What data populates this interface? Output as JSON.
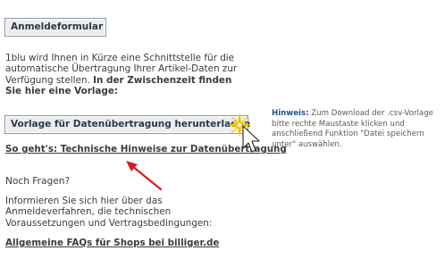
{
  "form": {
    "anmelde_button": "Anmeldeformular",
    "intro_text": "1blu wird Ihnen in Kürze eine Schnittstelle für die automatische Übertragung Ihrer Artikel-Daten zur Verfügung stellen.",
    "intro_bold": "In der Zwischenzeit finden Sie hier eine Vorlage:",
    "vorlage_button": "Vorlage für Datenübertragung herunterladen",
    "technik_link": "So geht's: Technische Hinweise zur Datenübertragung",
    "fragen_heading": "Noch Fragen?",
    "info_text": "Informieren Sie sich hier über das Anmeldeverfahren, die technischen Voraussetzungen und Vertragsbedingungen:",
    "faq_link": "Allgemeine FAQs für Shops bei billiger.de"
  },
  "hint": {
    "label": "Hinweis:",
    "text": "Zum Download der .csv-Vorlage bitte rechte Maustaste klicken und anschließend Funktion \"Datei speichern unter\" auswählen."
  },
  "annotations": {
    "arrow_color": "#d81e1e",
    "cursor_icon": "pointer-cursor-icon",
    "sparkle_color": "#f2c200"
  }
}
